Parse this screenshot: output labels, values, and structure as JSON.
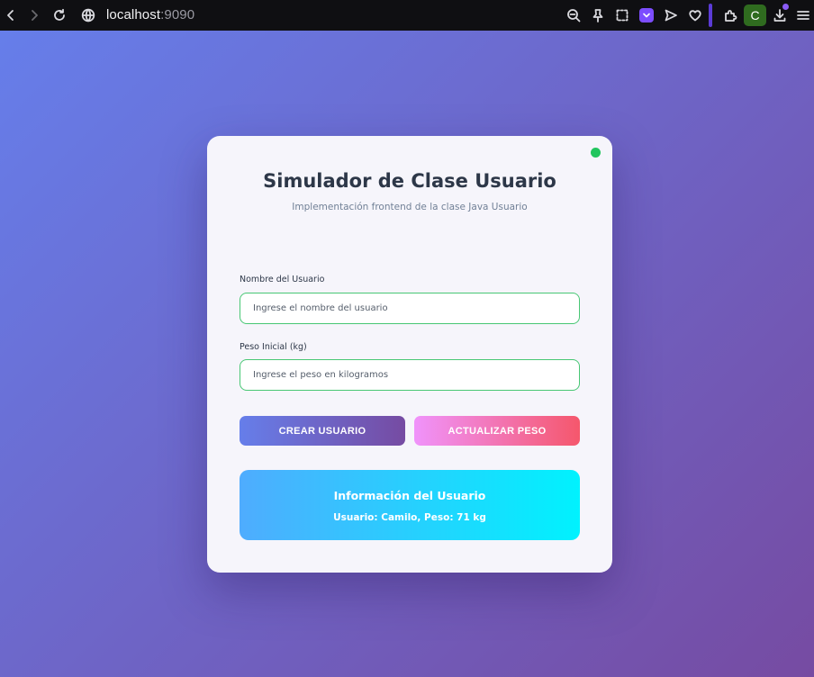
{
  "browser": {
    "url_host": "localhost",
    "url_port": ":9090",
    "profile_initial": "C",
    "icons": [
      "back-icon",
      "forward-icon",
      "reload-icon",
      "site-info-icon",
      "zoom-out-icon",
      "pin-icon",
      "screenshot-icon",
      "pocket-icon",
      "send-icon",
      "heart-icon",
      "extensions-icon",
      "downloads-icon",
      "menu-icon"
    ]
  },
  "card": {
    "title": "Simulador de Clase Usuario",
    "subtitle": "Implementación frontend de la clase Java Usuario",
    "status_color": "#22c55e"
  },
  "form": {
    "name_label": "Nombre del Usuario",
    "name_placeholder": "Ingrese el nombre del usuario",
    "name_value": "",
    "weight_label": "Peso Inicial (kg)",
    "weight_placeholder": "Ingrese el peso en kilogramos",
    "weight_value": ""
  },
  "buttons": {
    "create_label": "CREAR USUARIO",
    "update_label": "ACTUALIZAR PESO"
  },
  "info": {
    "title": "Información del Usuario",
    "text": "Usuario: Camilo, Peso: 71 kg"
  },
  "colors": {
    "bg_gradient_start": "#667eea",
    "bg_gradient_end": "#764ba2",
    "input_border": "#48c774",
    "info_gradient_start": "#4facfe",
    "info_gradient_end": "#00f2fe"
  }
}
